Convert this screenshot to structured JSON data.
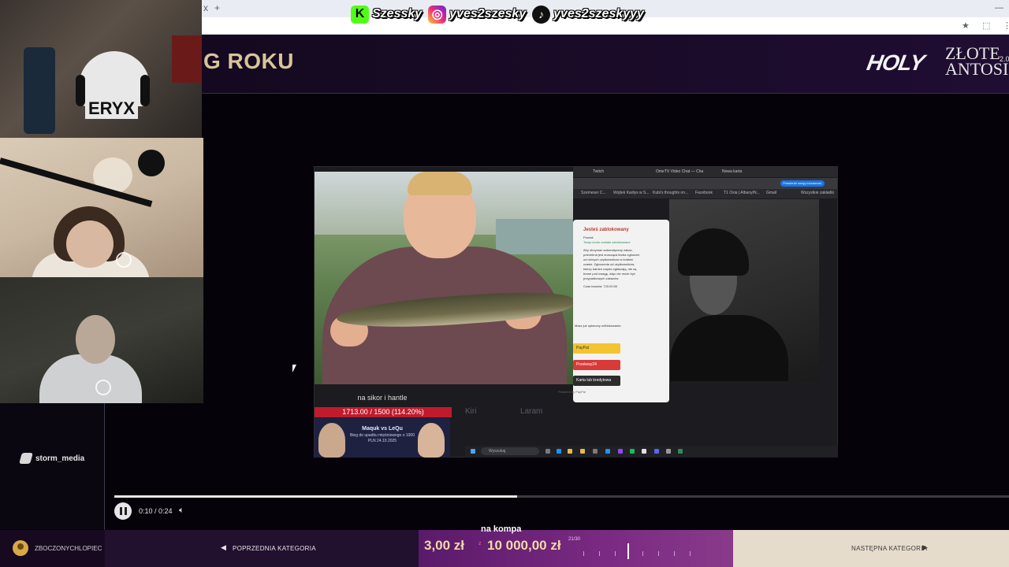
{
  "social": {
    "kick_icon": "kick-icon",
    "kick_handle": "Szessky",
    "instagram_icon": "instagram-icon",
    "instagram_handle": "yves2szesky",
    "tiktok_icon": "tiktok-icon",
    "tiktok_handle": "yves2szeskyyy"
  },
  "browser": {
    "new_tab_glyph": "+",
    "close_tab_glyph": "x",
    "minimize_glyph": "—",
    "star_glyph": "★",
    "extensions_glyph": "⬚",
    "menu_glyph": "⋮"
  },
  "event": {
    "title": "G ROKU",
    "brand_holy": "HOLY",
    "brand_line1": "ZŁOTE",
    "brand_line2": "ANTOSI",
    "brand_version": "2.0"
  },
  "preview": {
    "tabs": [
      "Twitch",
      "OmeTV Video Chat — Cha",
      "Nowa karta"
    ],
    "bookmarks": [
      "Szemeser C...",
      "Wojtek Kariłys w S...",
      "Kubi's thoughts on...",
      "Facebook",
      "T1 Osia | Albany/N...",
      "Gmail",
      "Wszystkie zakładki"
    ],
    "secure_label": "Potwierdź swoją tożsamość",
    "dialog": {
      "title": "Jesteś zablokowany",
      "reason_label": "Powód:",
      "reason_value": "Twoje konto zostało zablokowane",
      "body": [
        "Aby otrzymać automatyczny zakaz,",
        "potrzebna jest znacząca liczba zgłoszeń",
        "od różnych użytkowników w krótkim",
        "czasie. Zgłoszenia od użytkowników,",
        "którzy bardzo często zgłaszają, nie są",
        "brane pod uwagę, więc nie może być",
        "przypadkowych zakazów."
      ],
      "time_left": "Czas trwania: 720:00:00",
      "unblock_line": "Masz już opłacony odblokowanie.",
      "btn_paypal": "PayPal",
      "btn_przelewy": "Przelewy24",
      "btn_card": "Karta lub kredytowa",
      "powered": "Powered by PayPal"
    },
    "caption": "na sikor i hantle",
    "goal_text": "1713.00 / 1500 (114.20%)",
    "promo_title": "Maquk vs LeQu",
    "promo_sub": "Bieg do upadku mięśniowego o 1000 PLN 24.10.2025",
    "search_placeholder": "Wyszukaj",
    "names": [
      "Kiri",
      "Laram"
    ]
  },
  "player": {
    "progress_fraction": 0.45,
    "time": "0:10 / 0:24",
    "pause_icon": "pause-icon",
    "volume_icon": "volume-icon"
  },
  "sidebar": {
    "brand": "storm_media"
  },
  "bottom": {
    "username": "ZBOCZONYCHLOPIEC",
    "prev_category": "POPRZEDNIA KATEGORIA",
    "donation_label": "na kompa",
    "donation_amount": "3,00 zł",
    "donation_separator": "z",
    "donation_target": "10 000,00 zł",
    "donation_count": "21/30",
    "next_category": "NASTĘPNA KATEGORIA"
  },
  "colors": {
    "accent_gold": "#d8c49a",
    "donation_purple": "#7a2a82",
    "next_bg": "#e6dccb",
    "goal_red": "#c01b2d"
  }
}
